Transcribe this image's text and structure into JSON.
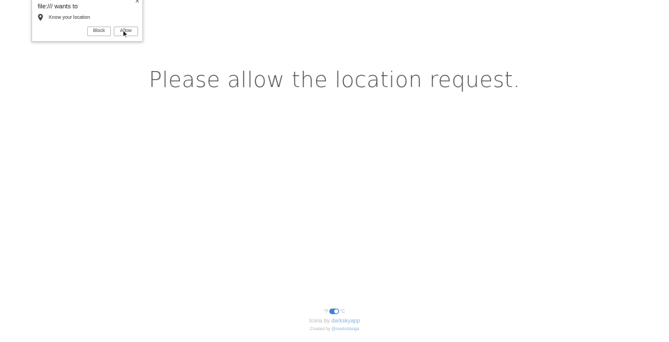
{
  "permission_popup": {
    "title": "file:/// wants to",
    "close_glyph": "×",
    "request": {
      "icon": "location-pin-icon",
      "label": "Know your location"
    },
    "block_label": "Block",
    "allow_label": "Allow"
  },
  "main": {
    "message": "Please allow the location request."
  },
  "footer": {
    "unit_left": "°F",
    "unit_right": "°C",
    "toggle_color": "#3b84d9",
    "icons_prefix": "Icons by",
    "icons_link": "darkskyapp",
    "created_prefix": "Created by",
    "created_link": "@martonlanga"
  }
}
